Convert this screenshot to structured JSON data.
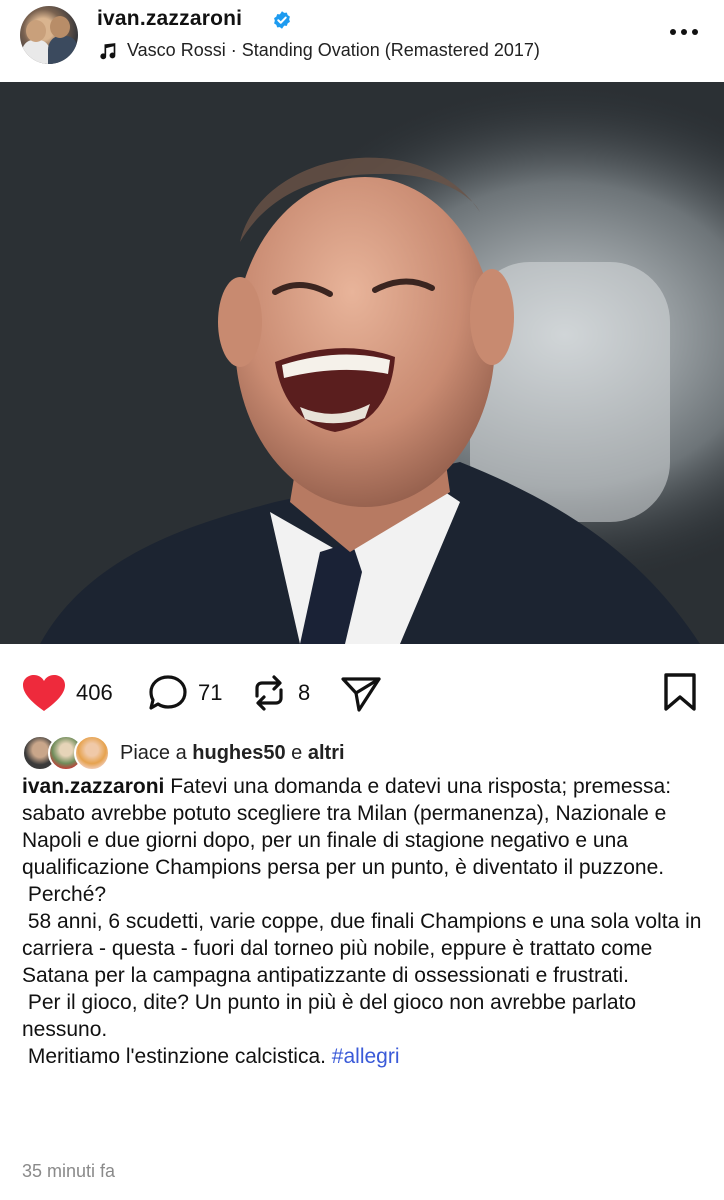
{
  "post": {
    "username": "ivan.zazzaroni",
    "music": "Vasco Rossi · Standing Ovation (Remastered 2017)"
  },
  "actions": {
    "likes": "406",
    "comments": "71",
    "reposts": "8"
  },
  "likes_summary": {
    "prefix": "Piace a ",
    "user": "hughes50",
    "middle": " e ",
    "others": "altri"
  },
  "caption": {
    "username": "ivan.zazzaroni",
    "paragraph1": "Fatevi una domanda e datevi una risposta; premessa: sabato avrebbe potuto scegliere tra Milan (permanenza), Nazionale e Napoli e due giorni dopo, per un finale di stagione negativo e una qualificazione Champions persa per un punto, è diventato il puzzone.",
    "paragraph2": " Perché?",
    "paragraph3": " 58 anni, 6 scudetti, varie coppe, due finali Champions e una sola volta in carriera - questa - fuori dal torneo più nobile, eppure è trattato come Satana per la campagna antipatizzante di ossessionati e frustrati.",
    "paragraph4": " Per il gioco, dite? Un punto in più è del gioco non avrebbe parlato nessuno.",
    "paragraph5": " Meritiamo l'estinzione calcistica. ",
    "hashtag": "#allegri"
  },
  "timestamp": "35 minuti fa",
  "colors": {
    "heart": "#ee2a3c",
    "verified": "#1d9bf0",
    "hashtag": "#3a5ad8"
  }
}
